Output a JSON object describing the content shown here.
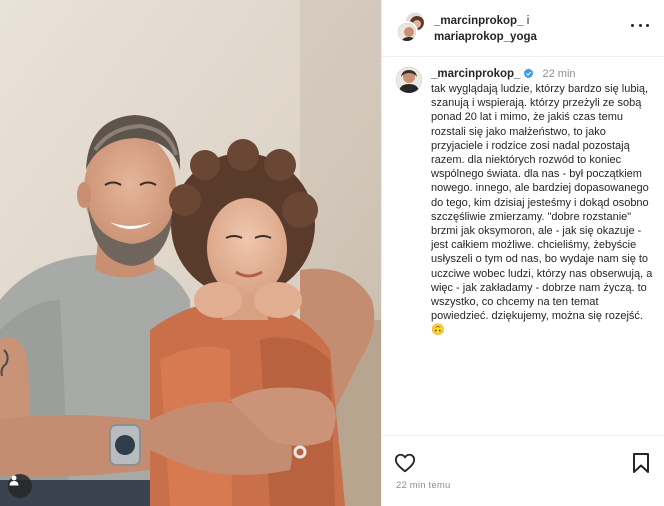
{
  "header": {
    "user1": "_marcinprokop_",
    "conjunction": "i",
    "user2": "mariaprokop_yoga",
    "more_icon": "more-horizontal-icon"
  },
  "caption": {
    "username": "_marcinprokop_",
    "verified_icon": "verified-badge-icon",
    "time": "22 min",
    "text": "tak wyglądają ludzie, którzy bardzo się lubią, szanują i wspierają. którzy przeżyli ze sobą ponad 20 lat i mimo, że jakiś czas temu rozstali się jako małżeństwo, to jako przyjaciele i rodzice zosi nadal pozostają razem. dla niektórych rozwód to koniec wspólnego świata. dla nas - był początkiem nowego. innego, ale bardziej dopasowanego do tego, kim dzisiaj jesteśmy i dokąd osobno szczęśliwie zmierzamy. \"dobre rozstanie\" brzmi jak oksymoron, ale - jak się okazuje - jest całkiem możliwe. chcieliśmy, żebyście usłyszeli o tym od nas, bo wydaje nam się to uczciwe wobec ludzi, którzy nas obserwują, a więc - jak zakładamy - dobrze nam życzą. to wszystko, co chcemy na ten temat powiedzieć. dziękujemy, można się rozejść. 🙃"
  },
  "actions": {
    "like_icon": "heart-icon",
    "save_icon": "bookmark-icon",
    "timestamp": "22 min temu"
  },
  "photo": {
    "tag_icon": "user-tag-icon"
  },
  "colors": {
    "verified": "#3897f0",
    "muted_text": "#8e8e8e",
    "border": "#efefef"
  }
}
